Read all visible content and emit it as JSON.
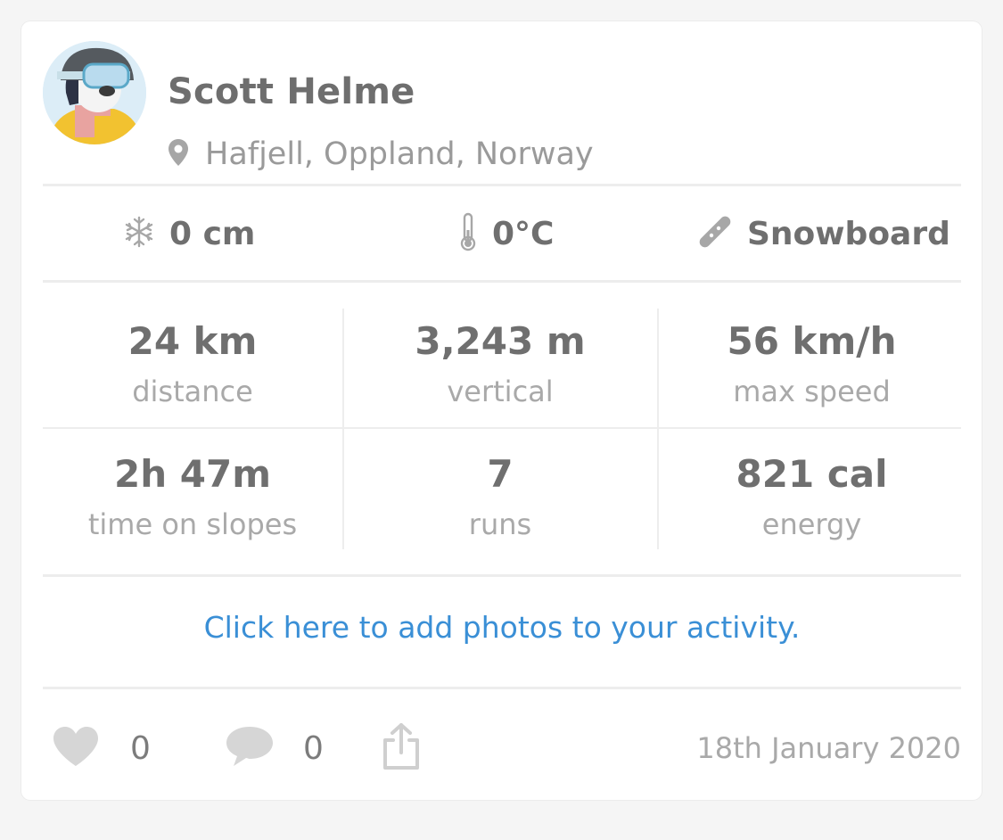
{
  "profile": {
    "name": "Scott Helme",
    "location": "Hafjell, Oppland, Norway"
  },
  "conditions": {
    "snow": "0 cm",
    "temperature": "0°C",
    "sport": "Snowboard"
  },
  "stats": [
    {
      "value": "24 km",
      "label": "distance"
    },
    {
      "value": "3,243 m",
      "label": "vertical"
    },
    {
      "value": "56 km/h",
      "label": "max speed"
    },
    {
      "value": "2h 47m",
      "label": "time on slopes"
    },
    {
      "value": "7",
      "label": "runs"
    },
    {
      "value": "821 cal",
      "label": "energy"
    }
  ],
  "photos_link": "Click here to add photos to your activity.",
  "footer": {
    "likes": "0",
    "comments": "0",
    "date": "18th January 2020"
  },
  "colors": {
    "link": "#3a8fd6",
    "heading": "#6f6f6f",
    "muted": "#a9a9a9",
    "icon": "#cfcfcf"
  },
  "icons": {
    "location": "map-pin-icon",
    "snow": "snowflake-icon",
    "temperature": "thermometer-icon",
    "sport": "snowboard-icon",
    "like": "heart-icon",
    "comment": "speech-bubble-icon",
    "share": "share-icon"
  }
}
